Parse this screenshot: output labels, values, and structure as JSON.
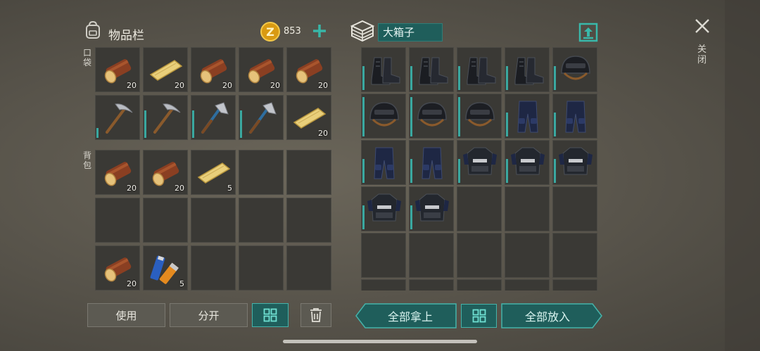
{
  "inventory": {
    "title": "物品栏",
    "coins": "853",
    "pocket_label": "口袋",
    "backpack_label": "背包"
  },
  "container": {
    "title": "大箱子"
  },
  "close_label": "关闭",
  "buttons": {
    "use": "使用",
    "split": "分开",
    "take_all": "全部拿上",
    "put_all": "全部放入"
  },
  "pocket_slots": [
    {
      "item": "log",
      "qty": "20"
    },
    {
      "item": "plank",
      "qty": "20"
    },
    {
      "item": "log",
      "qty": "20"
    },
    {
      "item": "log",
      "qty": "20"
    },
    {
      "item": "log",
      "qty": "20"
    },
    {
      "item": "pickaxe",
      "qty": "",
      "durability": 0.25
    },
    {
      "item": "pickaxe",
      "qty": "",
      "durability": 0.7
    },
    {
      "item": "axe",
      "qty": "",
      "durability": 0.7
    },
    {
      "item": "axe",
      "qty": "",
      "durability": 0.7
    },
    {
      "item": "plank",
      "qty": "20"
    }
  ],
  "backpack_slots": [
    {
      "item": "log",
      "qty": "20"
    },
    {
      "item": "log",
      "qty": "20"
    },
    {
      "item": "plank",
      "qty": "5"
    },
    {
      "item": "",
      "qty": ""
    },
    {
      "item": "",
      "qty": ""
    },
    {
      "item": "",
      "qty": ""
    },
    {
      "item": "",
      "qty": ""
    },
    {
      "item": "",
      "qty": ""
    },
    {
      "item": "",
      "qty": ""
    },
    {
      "item": "",
      "qty": ""
    },
    {
      "item": "log",
      "qty": "20"
    },
    {
      "item": "batteries",
      "qty": "5"
    },
    {
      "item": "",
      "qty": ""
    },
    {
      "item": "",
      "qty": ""
    },
    {
      "item": "",
      "qty": ""
    }
  ],
  "container_slots": [
    {
      "item": "boots",
      "durability": 0.6
    },
    {
      "item": "boots",
      "durability": 0.6
    },
    {
      "item": "boots",
      "durability": 0.6
    },
    {
      "item": "boots",
      "durability": 0.6
    },
    {
      "item": "helmet",
      "durability": 0.6
    },
    {
      "item": "helmet",
      "durability": 1.0
    },
    {
      "item": "helmet",
      "durability": 1.0
    },
    {
      "item": "helmet",
      "durability": 1.0
    },
    {
      "item": "pants",
      "durability": 0.6
    },
    {
      "item": "pants",
      "durability": 0.6
    },
    {
      "item": "pants",
      "durability": 0.6
    },
    {
      "item": "pants",
      "durability": 0.6
    },
    {
      "item": "vest",
      "durability": 0.6
    },
    {
      "item": "vest",
      "durability": 0.6
    },
    {
      "item": "vest",
      "durability": 0.6
    },
    {
      "item": "vest",
      "durability": 0.6
    },
    {
      "item": "vest",
      "durability": 0.6
    },
    {
      "item": "",
      "durability": 0
    },
    {
      "item": "",
      "durability": 0
    },
    {
      "item": "",
      "durability": 0
    },
    {
      "item": "",
      "durability": 0
    },
    {
      "item": "",
      "durability": 0
    },
    {
      "item": "",
      "durability": 0
    },
    {
      "item": "",
      "durability": 0
    },
    {
      "item": "",
      "durability": 0
    },
    {
      "item": "",
      "durability": 0
    },
    {
      "item": "",
      "durability": 0
    },
    {
      "item": "",
      "durability": 0
    },
    {
      "item": "",
      "durability": 0
    },
    {
      "item": "",
      "durability": 0
    }
  ],
  "colors": {
    "accent": "#3aa8a0",
    "button_teal": "#1f5e5b",
    "coin": "#e8b020"
  }
}
